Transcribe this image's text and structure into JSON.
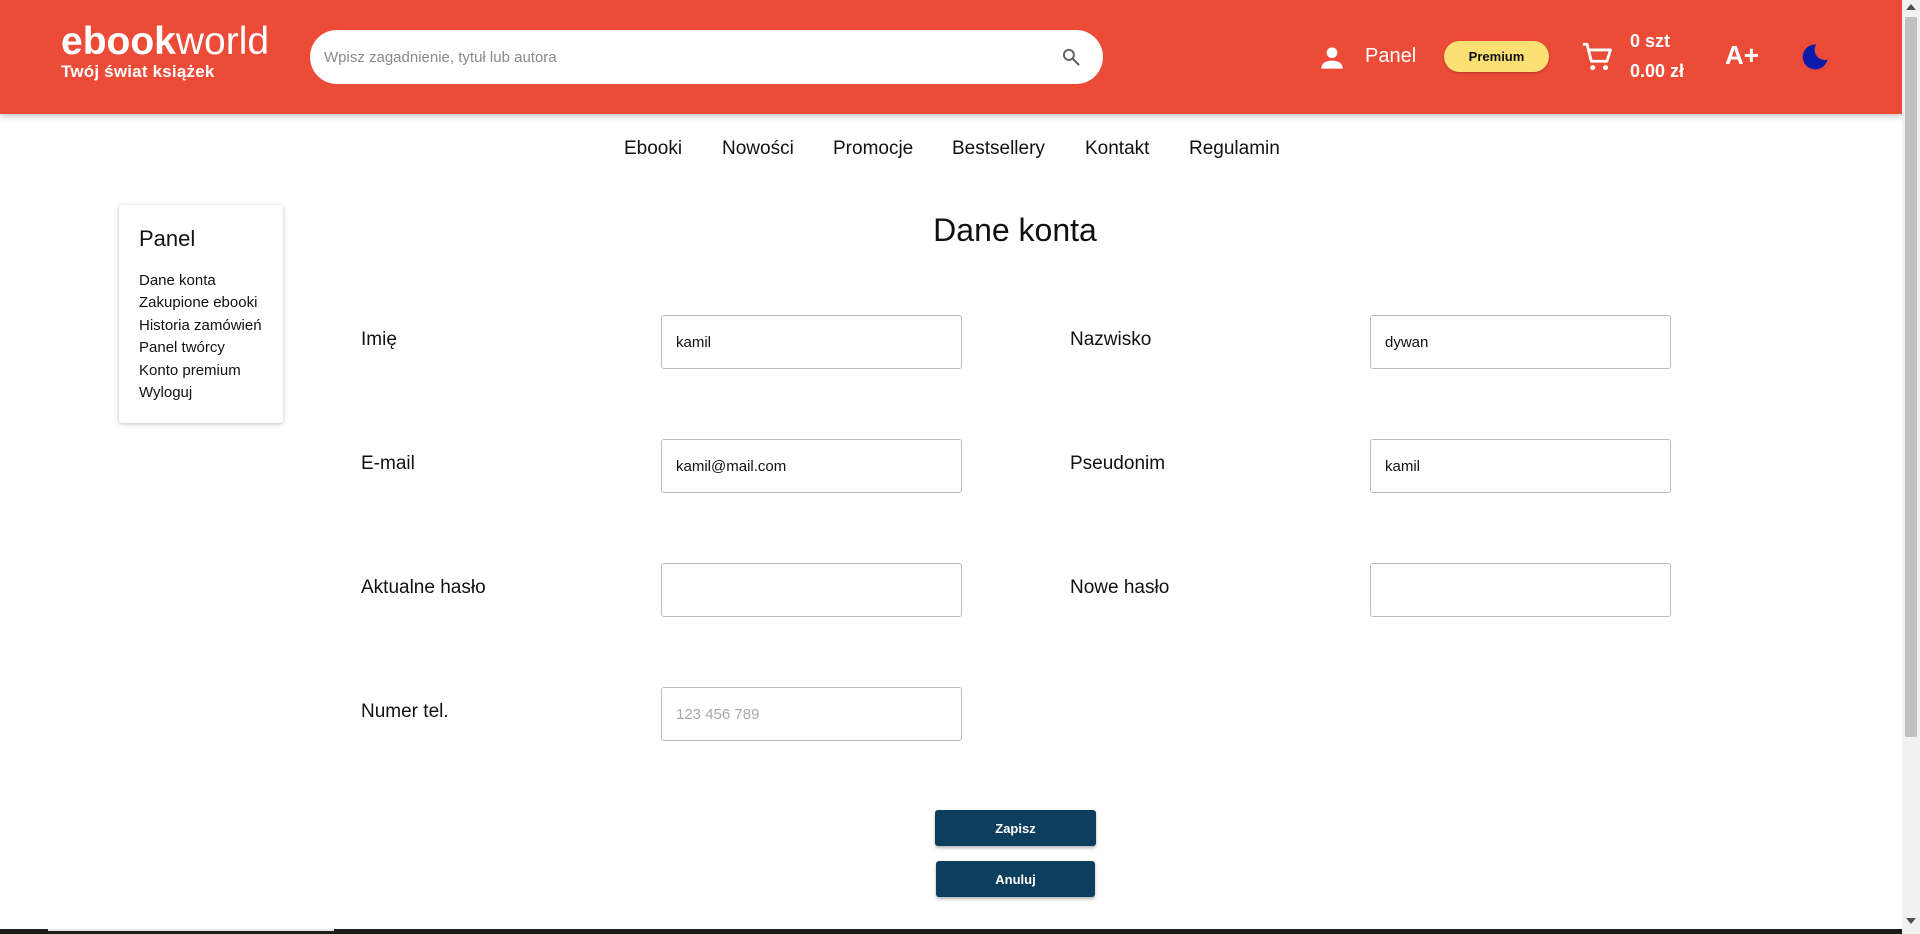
{
  "header": {
    "logo_bold": "ebook",
    "logo_light": "world",
    "tagline": "Twój świat książek",
    "search_placeholder": "Wpisz zagadnienie, tytuł lub autora",
    "panel_label": "Panel",
    "premium_label": "Premium",
    "cart_qty": "0 szt",
    "cart_total": "0.00 zł",
    "font_size_label": "A+",
    "colors": {
      "header_bg": "#ec4b37",
      "premium_bg": "#fde073",
      "moon": "#0b1aa8"
    }
  },
  "nav": {
    "items": [
      "Ebooki",
      "Nowości",
      "Promocje",
      "Bestsellery",
      "Kontakt",
      "Regulamin"
    ]
  },
  "sidebar": {
    "title": "Panel",
    "items": [
      "Dane konta",
      "Zakupione ebooki",
      "Historia zamówień",
      "Panel twórcy",
      "Konto premium",
      "Wyloguj"
    ]
  },
  "form": {
    "title": "Dane konta",
    "first_name": {
      "label": "Imię",
      "value": "kamil"
    },
    "last_name": {
      "label": "Nazwisko",
      "value": "dywan"
    },
    "email": {
      "label": "E-mail",
      "value": "kamil@mail.com"
    },
    "nickname": {
      "label": "Pseudonim",
      "value": "kamil"
    },
    "current_password": {
      "label": "Aktualne hasło",
      "value": ""
    },
    "new_password": {
      "label": "Nowe hasło",
      "value": ""
    },
    "phone": {
      "label": "Numer tel.",
      "value": "",
      "placeholder": "123 456 789"
    },
    "save_label": "Zapisz",
    "cancel_label": "Anuluj",
    "colors": {
      "button_bg": "#0c3f5e"
    }
  }
}
